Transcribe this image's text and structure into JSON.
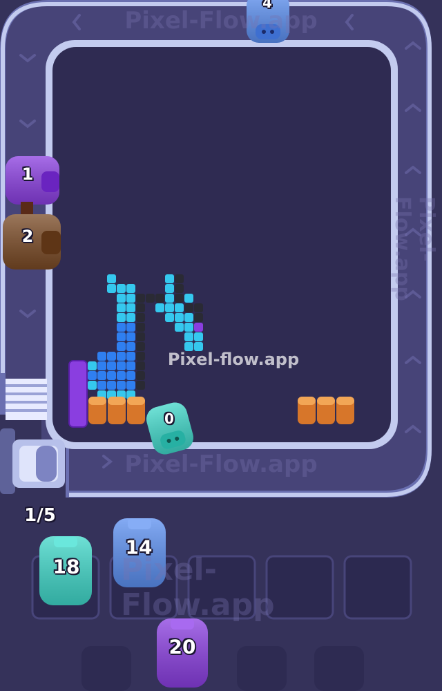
{
  "watermark": "Pixel-flow.app",
  "watermark_track_bottom": "Pixel-Flow.app",
  "watermark_track_right": "Pixel-Flow.app",
  "watermark_track_top": "Pixel-Flow.app",
  "watermark_slots": "Pixel-Flow.app",
  "queue_counter": "1/5",
  "pigs": {
    "top": {
      "count": "4",
      "color": "#5b8ff0"
    },
    "left_purple": {
      "count": "1",
      "color": "#8a3ee0"
    },
    "left_brown": {
      "count": "2",
      "color": "#7a4a25"
    },
    "board": {
      "count": "0",
      "color": "#3fd6c8"
    },
    "slot_1": {
      "count": "18",
      "color": "#3fd6c8"
    },
    "slot_2": {
      "count": "14",
      "color": "#5b8ff0"
    },
    "waiting": {
      "count": "20",
      "color": "#8a3ee0"
    }
  },
  "colors": {
    "background": "#35325a",
    "track": "#a9b4e6",
    "board": "#2f2b52",
    "cyan": "#35c8ee",
    "blue": "#2f7ff0",
    "dark": "#2a2a34",
    "purple": "#8a3ee0",
    "orange": "#d7762a"
  }
}
